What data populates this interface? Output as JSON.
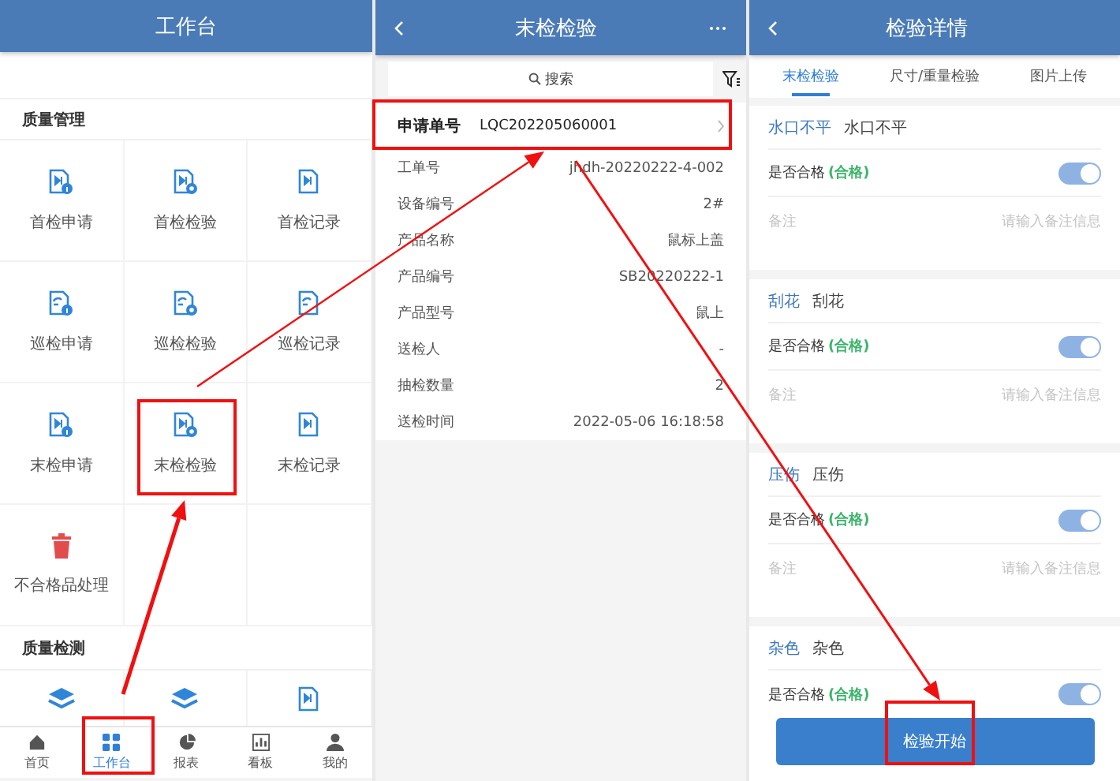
{
  "workbench": {
    "title": "工作台",
    "sections": [
      {
        "title": "质量管理",
        "items": [
          {
            "label": "首检申请",
            "kind": "apply"
          },
          {
            "label": "首检检验",
            "kind": "inspect"
          },
          {
            "label": "首检记录",
            "kind": "record"
          },
          {
            "label": "巡检申请",
            "kind": "apply2"
          },
          {
            "label": "巡检检验",
            "kind": "inspect2"
          },
          {
            "label": "巡检记录",
            "kind": "record2"
          },
          {
            "label": "末检申请",
            "kind": "apply"
          },
          {
            "label": "末检检验",
            "kind": "inspect"
          },
          {
            "label": "末检记录",
            "kind": "record"
          },
          {
            "label": "不合格品处理",
            "kind": "trash"
          }
        ]
      },
      {
        "title": "质量检测",
        "items": [
          {
            "kind": "layers"
          },
          {
            "kind": "layers"
          },
          {
            "kind": "record"
          }
        ]
      }
    ],
    "nav": [
      {
        "label": "首页",
        "selected": false
      },
      {
        "label": "工作台",
        "selected": true
      },
      {
        "label": "报表",
        "selected": false
      },
      {
        "label": "看板",
        "selected": false
      },
      {
        "label": "我的",
        "selected": false
      }
    ]
  },
  "list": {
    "title": "末检检验",
    "search": {
      "placeholder": "搜索"
    },
    "rows": [
      {
        "label": "申请单号",
        "value": "LQC202205060001",
        "kind": "header"
      },
      {
        "label": "工单号",
        "value": "jhdh-20220222-4-002",
        "kind": "field"
      },
      {
        "label": "设备编号",
        "value": "2#",
        "kind": "field"
      },
      {
        "label": "产品名称",
        "value": "鼠标上盖",
        "kind": "field"
      },
      {
        "label": "产品编号",
        "value": "SB20220222-1",
        "kind": "field"
      },
      {
        "label": "产品型号",
        "value": "鼠上",
        "kind": "field"
      },
      {
        "label": "送检人",
        "value": "-",
        "kind": "field"
      },
      {
        "label": "抽检数量",
        "value": "2",
        "kind": "field"
      },
      {
        "label": "送检时间",
        "value": "2022-05-06 16:18:58",
        "kind": "field"
      }
    ]
  },
  "detail": {
    "title": "检验详情",
    "tabs": [
      {
        "label": "末检检验",
        "selected": true
      },
      {
        "label": "尺寸/重量检验",
        "selected": false
      },
      {
        "label": "图片上传",
        "selected": false
      }
    ],
    "cards": [
      {
        "category": "水口不平",
        "name": "水口不平",
        "pass_label": "是否合格",
        "status": "(合格)",
        "on": true,
        "remark_label": "备注",
        "remark_placeholder": "请输入备注信息"
      },
      {
        "category": "刮花",
        "name": "刮花",
        "pass_label": "是否合格",
        "status": "(合格)",
        "on": true,
        "remark_label": "备注",
        "remark_placeholder": "请输入备注信息"
      },
      {
        "category": "压伤",
        "name": "压伤",
        "pass_label": "是否合格",
        "status": "(合格)",
        "on": true,
        "remark_label": "备注",
        "remark_placeholder": "请输入备注信息"
      },
      {
        "category": "杂色",
        "name": "杂色",
        "pass_label": "是否合格",
        "status": "(合格)",
        "on": true
      }
    ],
    "button": "检验开始"
  }
}
